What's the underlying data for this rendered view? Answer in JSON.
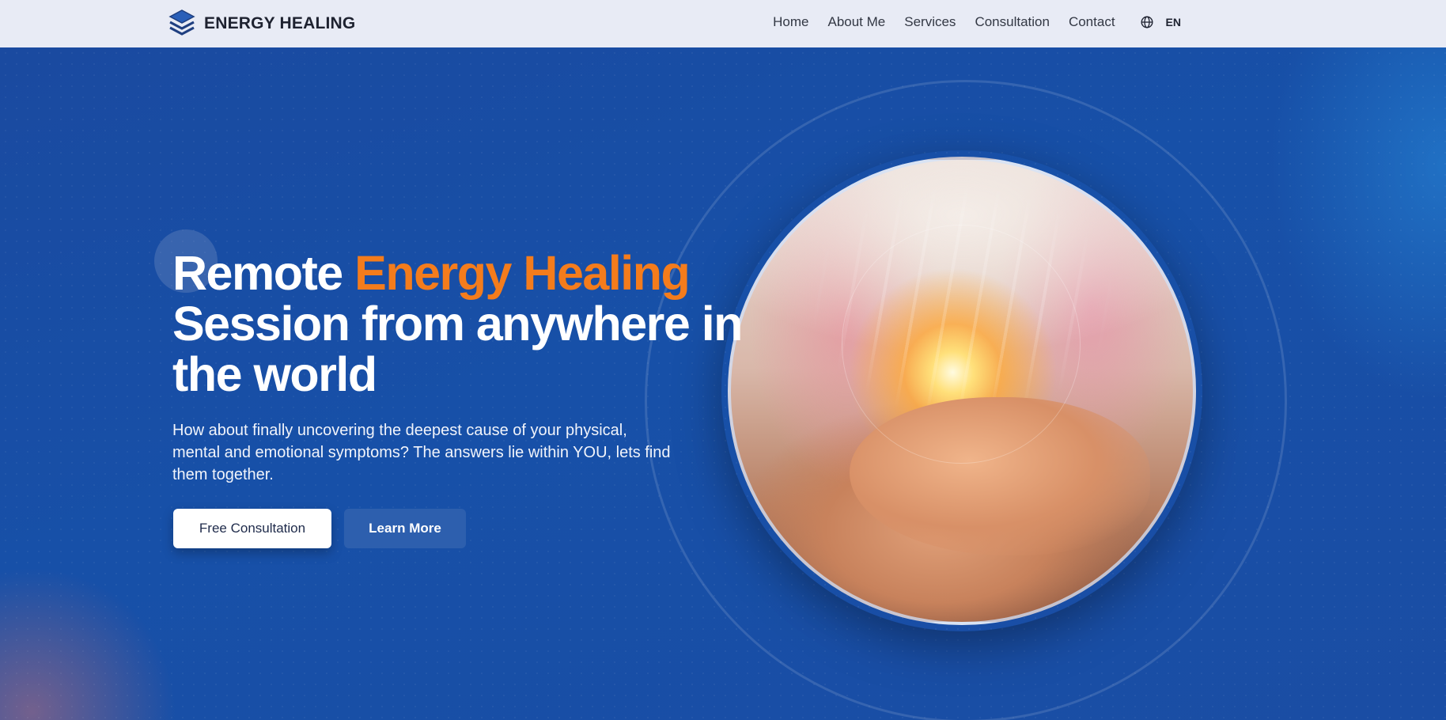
{
  "header": {
    "brand": "ENERGY HEALING",
    "logo_icon": "stacked-layers-icon",
    "nav": [
      {
        "label": "Home"
      },
      {
        "label": "About Me"
      },
      {
        "label": "Services"
      },
      {
        "label": "Consultation"
      },
      {
        "label": "Contact"
      }
    ],
    "language": {
      "icon": "globe-icon",
      "label": "EN"
    }
  },
  "hero": {
    "title_part1": "Remote",
    "title_accent": "Energy Healing",
    "title_part2": "Session from anywhere in the world",
    "subtitle": "How about finally uncovering the deepest cause of your physical, mental and emotional symptoms? The answers lie within YOU, lets find them together.",
    "primary_button": "Free Consultation",
    "secondary_button": "Learn More"
  },
  "colors": {
    "accent": "#f47c1c",
    "hero_background": "#1b4a9e",
    "header_background": "#e8ebf5"
  }
}
